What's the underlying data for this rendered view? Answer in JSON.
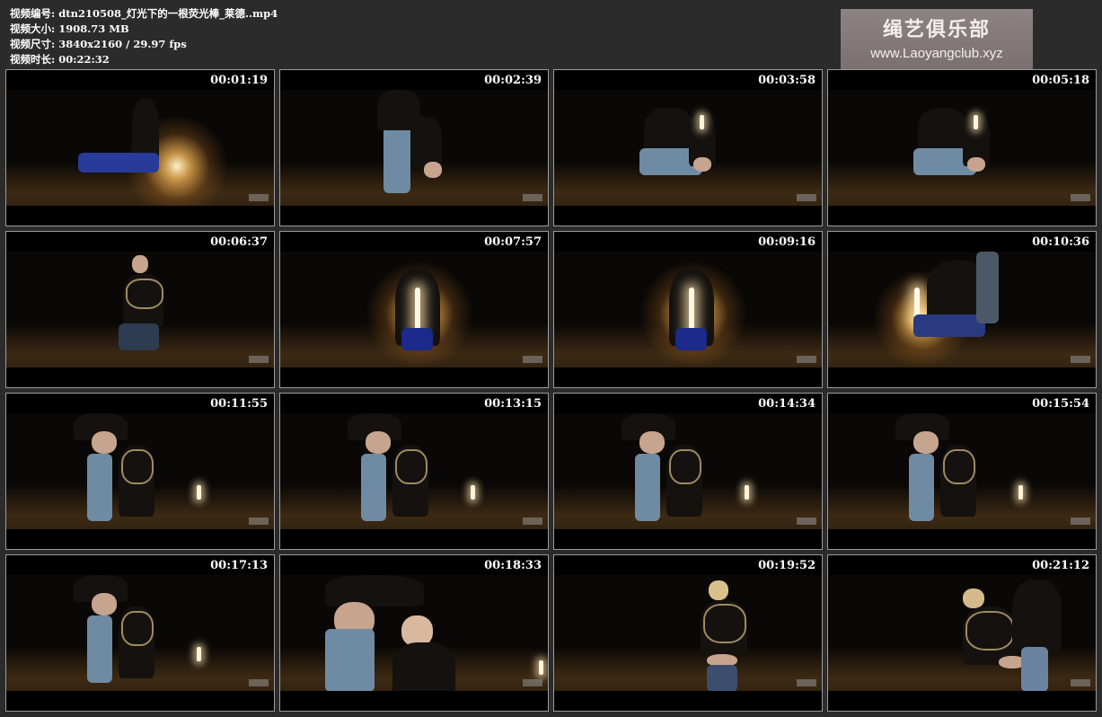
{
  "info": {
    "rows": [
      {
        "label": "视频编号:",
        "value": "dtn210508_灯光下的一根荧光棒_莱德..mp4"
      },
      {
        "label": "视频大小:",
        "value": "1908.73 MB"
      },
      {
        "label": "视频尺寸:",
        "value": "3840x2160 / 29.97 fps"
      },
      {
        "label": "视频时长:",
        "value": "00:22:32"
      }
    ]
  },
  "watermark": {
    "title": "绳艺俱乐部",
    "url": "www.Laoyangclub.xyz"
  },
  "thumbnails": [
    {
      "timestamp": "00:01:19",
      "scene": "lantern-ground"
    },
    {
      "timestamp": "00:02:39",
      "scene": "standing-couple"
    },
    {
      "timestamp": "00:03:58",
      "scene": "kneeling-couple"
    },
    {
      "timestamp": "00:05:18",
      "scene": "kneeling-couple-2"
    },
    {
      "timestamp": "00:06:37",
      "scene": "kneeling-woman"
    },
    {
      "timestamp": "00:07:57",
      "scene": "glow-stick"
    },
    {
      "timestamp": "00:09:16",
      "scene": "glow-stick-2"
    },
    {
      "timestamp": "00:10:36",
      "scene": "glow-stick-side"
    },
    {
      "timestamp": "00:11:55",
      "scene": "standing-pair"
    },
    {
      "timestamp": "00:13:15",
      "scene": "standing-pair"
    },
    {
      "timestamp": "00:14:34",
      "scene": "standing-pair"
    },
    {
      "timestamp": "00:15:54",
      "scene": "standing-pair"
    },
    {
      "timestamp": "00:17:13",
      "scene": "standing-pair"
    },
    {
      "timestamp": "00:18:33",
      "scene": "closeup-pair"
    },
    {
      "timestamp": "00:19:52",
      "scene": "standing-woman"
    },
    {
      "timestamp": "00:21:12",
      "scene": "couple-side"
    }
  ]
}
